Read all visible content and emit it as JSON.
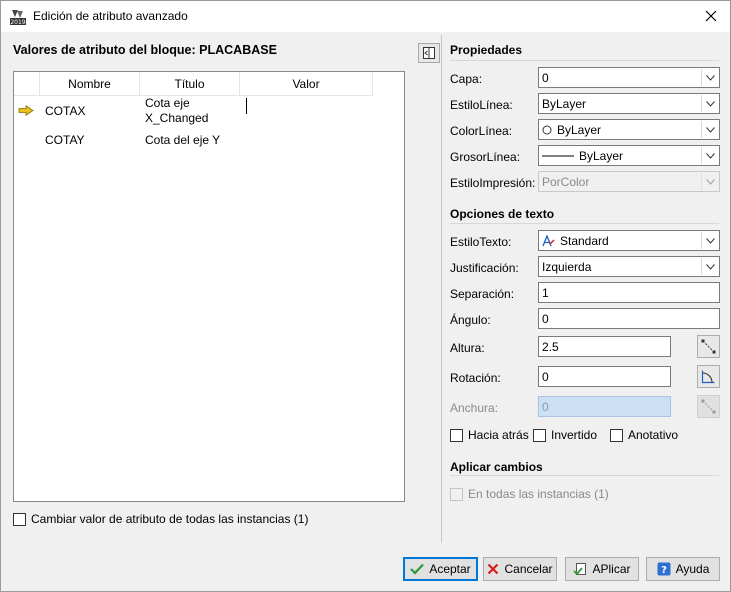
{
  "window": {
    "title": "Edición de atributo avanzado",
    "icon_badge": "2019"
  },
  "left": {
    "title": "Valores de atributo del bloque: PLACABASE",
    "columns": [
      "Nombre",
      "Título",
      "Valor"
    ],
    "rows": [
      {
        "name": "COTAX",
        "title_line1": "Cota eje",
        "title_line2": "X_Changed",
        "value": ""
      },
      {
        "name": "COTAY",
        "title_line1": "Cota del eje Y",
        "title_line2": "",
        "value": ""
      }
    ],
    "change_all_label": "Cambiar valor de atributo de todas las instancias (1)"
  },
  "properties": {
    "title": "Propiedades",
    "capa_label": "Capa:",
    "capa_value": "0",
    "estilolinea_label": "EstiloLínea:",
    "estilolinea_value": "ByLayer",
    "colorlinea_label": "ColorLínea:",
    "colorlinea_value": "ByLayer",
    "grosorlinea_label": "GrosorLínea:",
    "grosorlinea_value": "ByLayer",
    "estiloimpresion_label": "EstiloImpresión:",
    "estiloimpresion_value": "PorColor"
  },
  "text_options": {
    "title": "Opciones de texto",
    "estilotexto_label": "EstiloTexto:",
    "estilotexto_value": "Standard",
    "justificacion_label": "Justificación:",
    "justificacion_value": "Izquierda",
    "separacion_label": "Separación:",
    "separacion_value": "1",
    "angulo_label": "Ángulo:",
    "angulo_value": "0",
    "altura_label": "Altura:",
    "altura_value": "2.5",
    "rotacion_label": "Rotación:",
    "rotacion_value": "0",
    "anchura_label": "Anchura:",
    "anchura_value": "0",
    "hacia_atras_label": "Hacia atrás",
    "invertido_label": "Invertido",
    "anotativo_label": "Anotativo"
  },
  "apply_changes": {
    "title": "Aplicar cambios",
    "all_instances_label": "En todas las instancias (1)"
  },
  "buttons": {
    "accept": "Aceptar",
    "cancel": "Cancelar",
    "apply": "APlicar",
    "help": "Ayuda"
  },
  "colors": {
    "accent_blue": "#0078d7",
    "arrow_yellow": "#e8c020",
    "check_green": "#2e9a3a",
    "cancel_red": "#d81e1e",
    "disabled_field": "#cce0f5"
  }
}
